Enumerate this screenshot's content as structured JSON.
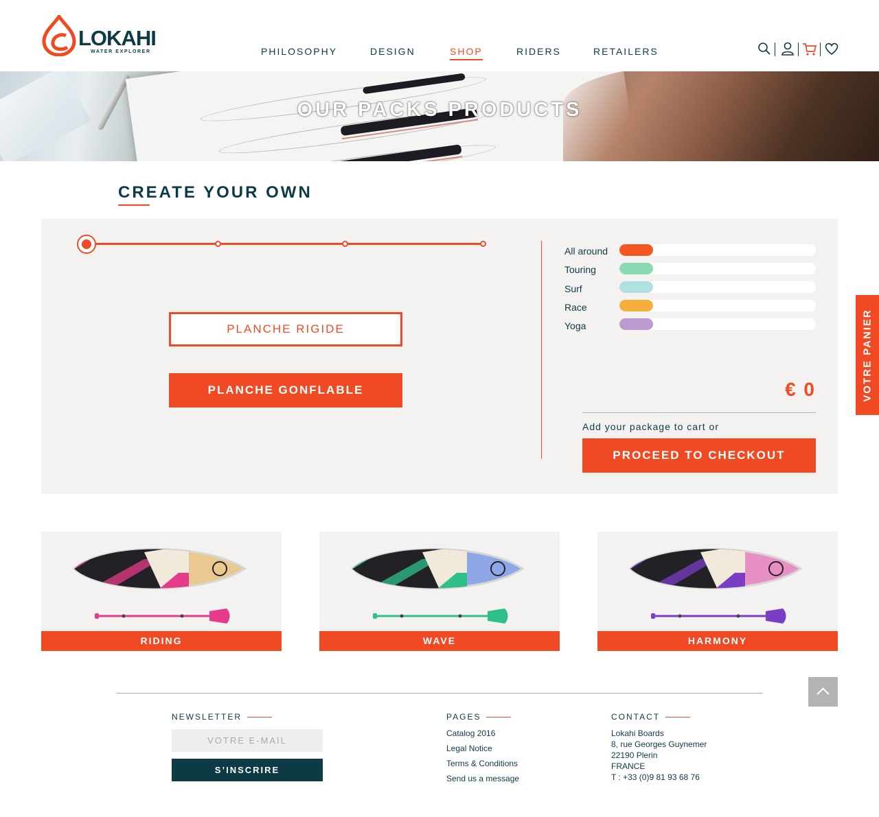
{
  "brand": {
    "name": "LOKAHI",
    "tagline": "WATER EXPLORER"
  },
  "nav": [
    {
      "label": "PHILOSOPHY"
    },
    {
      "label": "DESIGN"
    },
    {
      "label": "SHOP",
      "active": true
    },
    {
      "label": "RIDERS"
    },
    {
      "label": "RETAILERS"
    }
  ],
  "tools": [
    "search-icon",
    "user-icon",
    "cart-icon",
    "heart-icon"
  ],
  "hero": {
    "title": "OUR PACKS PRODUCTS"
  },
  "create": {
    "title": "CREATE YOUR OWN",
    "steps_total": 4,
    "current_step": 1,
    "option_rigid": "PLANCHE RIGIDE",
    "option_inflatable": "PLANCHE GONFLABLE",
    "categories": [
      {
        "label": "All around",
        "color": "#f4571f",
        "level": 0.17
      },
      {
        "label": "Touring",
        "color": "#8ad9b4",
        "level": 0.17
      },
      {
        "label": "Surf",
        "color": "#b0e0df",
        "level": 0.17
      },
      {
        "label": "Race",
        "color": "#f6ae3c",
        "level": 0.17
      },
      {
        "label": "Yoga",
        "color": "#bd9acf",
        "level": 0.17
      }
    ],
    "price": "€ 0",
    "cart_note": "Add your package to cart or",
    "checkout_label": "PROCEED TO CHECKOUT"
  },
  "side_tab": {
    "label": "VOTRE PANIER"
  },
  "packs": [
    {
      "label": "RIDING",
      "accent": "#e63b8a",
      "nose": "#e9c98f"
    },
    {
      "label": "WAVE",
      "accent": "#2fbf8a",
      "nose": "#8fa7e6"
    },
    {
      "label": "HARMONY",
      "accent": "#7a3ec4",
      "nose": "#e88fc4"
    }
  ],
  "footer": {
    "newsletter": {
      "heading": "NEWSLETTER",
      "placeholder": "VOTRE E-MAIL",
      "button": "S’INSCRIRE"
    },
    "pages": {
      "heading": "PAGES",
      "links": [
        "Catalog 2016",
        "Legal Notice",
        "Terms & Conditions",
        "Send us a message"
      ]
    },
    "contact": {
      "heading": "CONTACT",
      "lines": [
        "Lokahi Boards",
        "8, rue Georges Guynemer",
        "22190 Plerin",
        "FRANCE",
        "T : +33 (0)9 81 93 68 76"
      ]
    }
  },
  "colors": {
    "accent": "#f04a24",
    "navy": "#0c3a45",
    "panel": "#f3f2f0"
  }
}
